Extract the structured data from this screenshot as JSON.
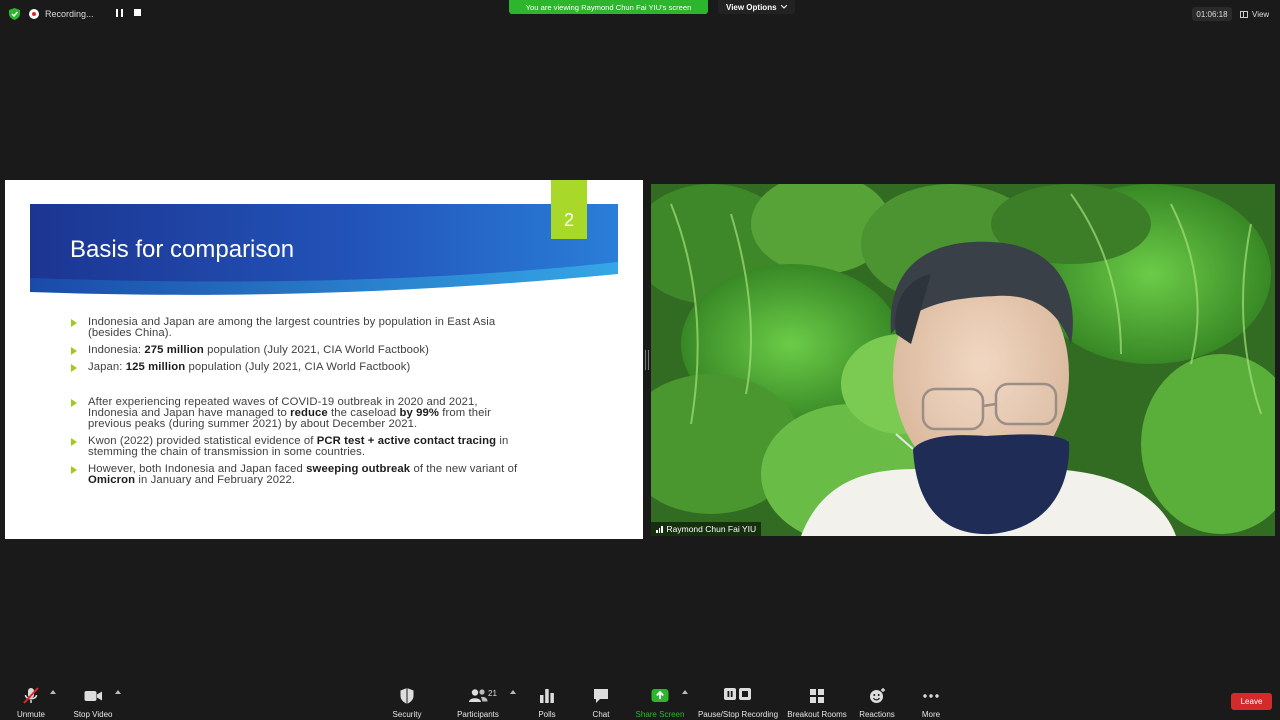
{
  "top_bar": {
    "recording_label": "Recording...",
    "viewing_banner": "You are viewing Raymond Chun Fai YIU's screen",
    "view_options_label": "View Options",
    "timer": "01:06:18",
    "view_label": "View"
  },
  "slide": {
    "title": "Basis for comparison",
    "number": "2",
    "accent_color": "#a8d82a",
    "banner_color": "#1f3fa0",
    "bullets": [
      {
        "segments": [
          {
            "t": "Indonesia and Japan are among the largest countries by population in East Asia (besides China)."
          }
        ]
      },
      {
        "segments": [
          {
            "t": "Indonesia: "
          },
          {
            "t": "275 million",
            "b": true
          },
          {
            "t": " population (July 2021, CIA World Factbook)"
          }
        ]
      },
      {
        "segments": [
          {
            "t": "Japan: "
          },
          {
            "t": "125 million",
            "b": true
          },
          {
            "t": " population (July 2021, CIA World Factbook)"
          }
        ]
      },
      {
        "gap": true,
        "segments": [
          {
            "t": "After experiencing repeated waves of COVID-19 outbreak in 2020 and 2021, Indonesia and Japan have managed to "
          },
          {
            "t": "reduce",
            "b": true
          },
          {
            "t": " the caseload "
          },
          {
            "t": "by 99%",
            "b": true
          },
          {
            "t": " from their previous peaks (during summer 2021) by about December 2021."
          }
        ]
      },
      {
        "segments": [
          {
            "t": "Kwon (2022) provided statistical evidence of "
          },
          {
            "t": "PCR test + active contact tracing",
            "b": true
          },
          {
            "t": " in stemming the chain of transmission in some countries."
          }
        ]
      },
      {
        "segments": [
          {
            "t": "However, both Indonesia and Japan faced "
          },
          {
            "t": "sweeping outbreak",
            "b": true
          },
          {
            "t": " of the new variant of "
          },
          {
            "t": "Omicron",
            "b": true
          },
          {
            "t": " in January and February 2022."
          }
        ]
      }
    ]
  },
  "video": {
    "participant_name": "Raymond Chun Fai YIU"
  },
  "toolbar": {
    "unmute": "Unmute",
    "stop_video": "Stop Video",
    "security": "Security",
    "participants": "Participants",
    "participants_count": "21",
    "polls": "Polls",
    "chat": "Chat",
    "share_screen": "Share Screen",
    "pause_stop_recording": "Pause/Stop Recording",
    "breakout_rooms": "Breakout Rooms",
    "reactions": "Reactions",
    "more": "More",
    "leave": "Leave",
    "share_color": "#2db52d",
    "leave_color": "#d42a2a"
  }
}
